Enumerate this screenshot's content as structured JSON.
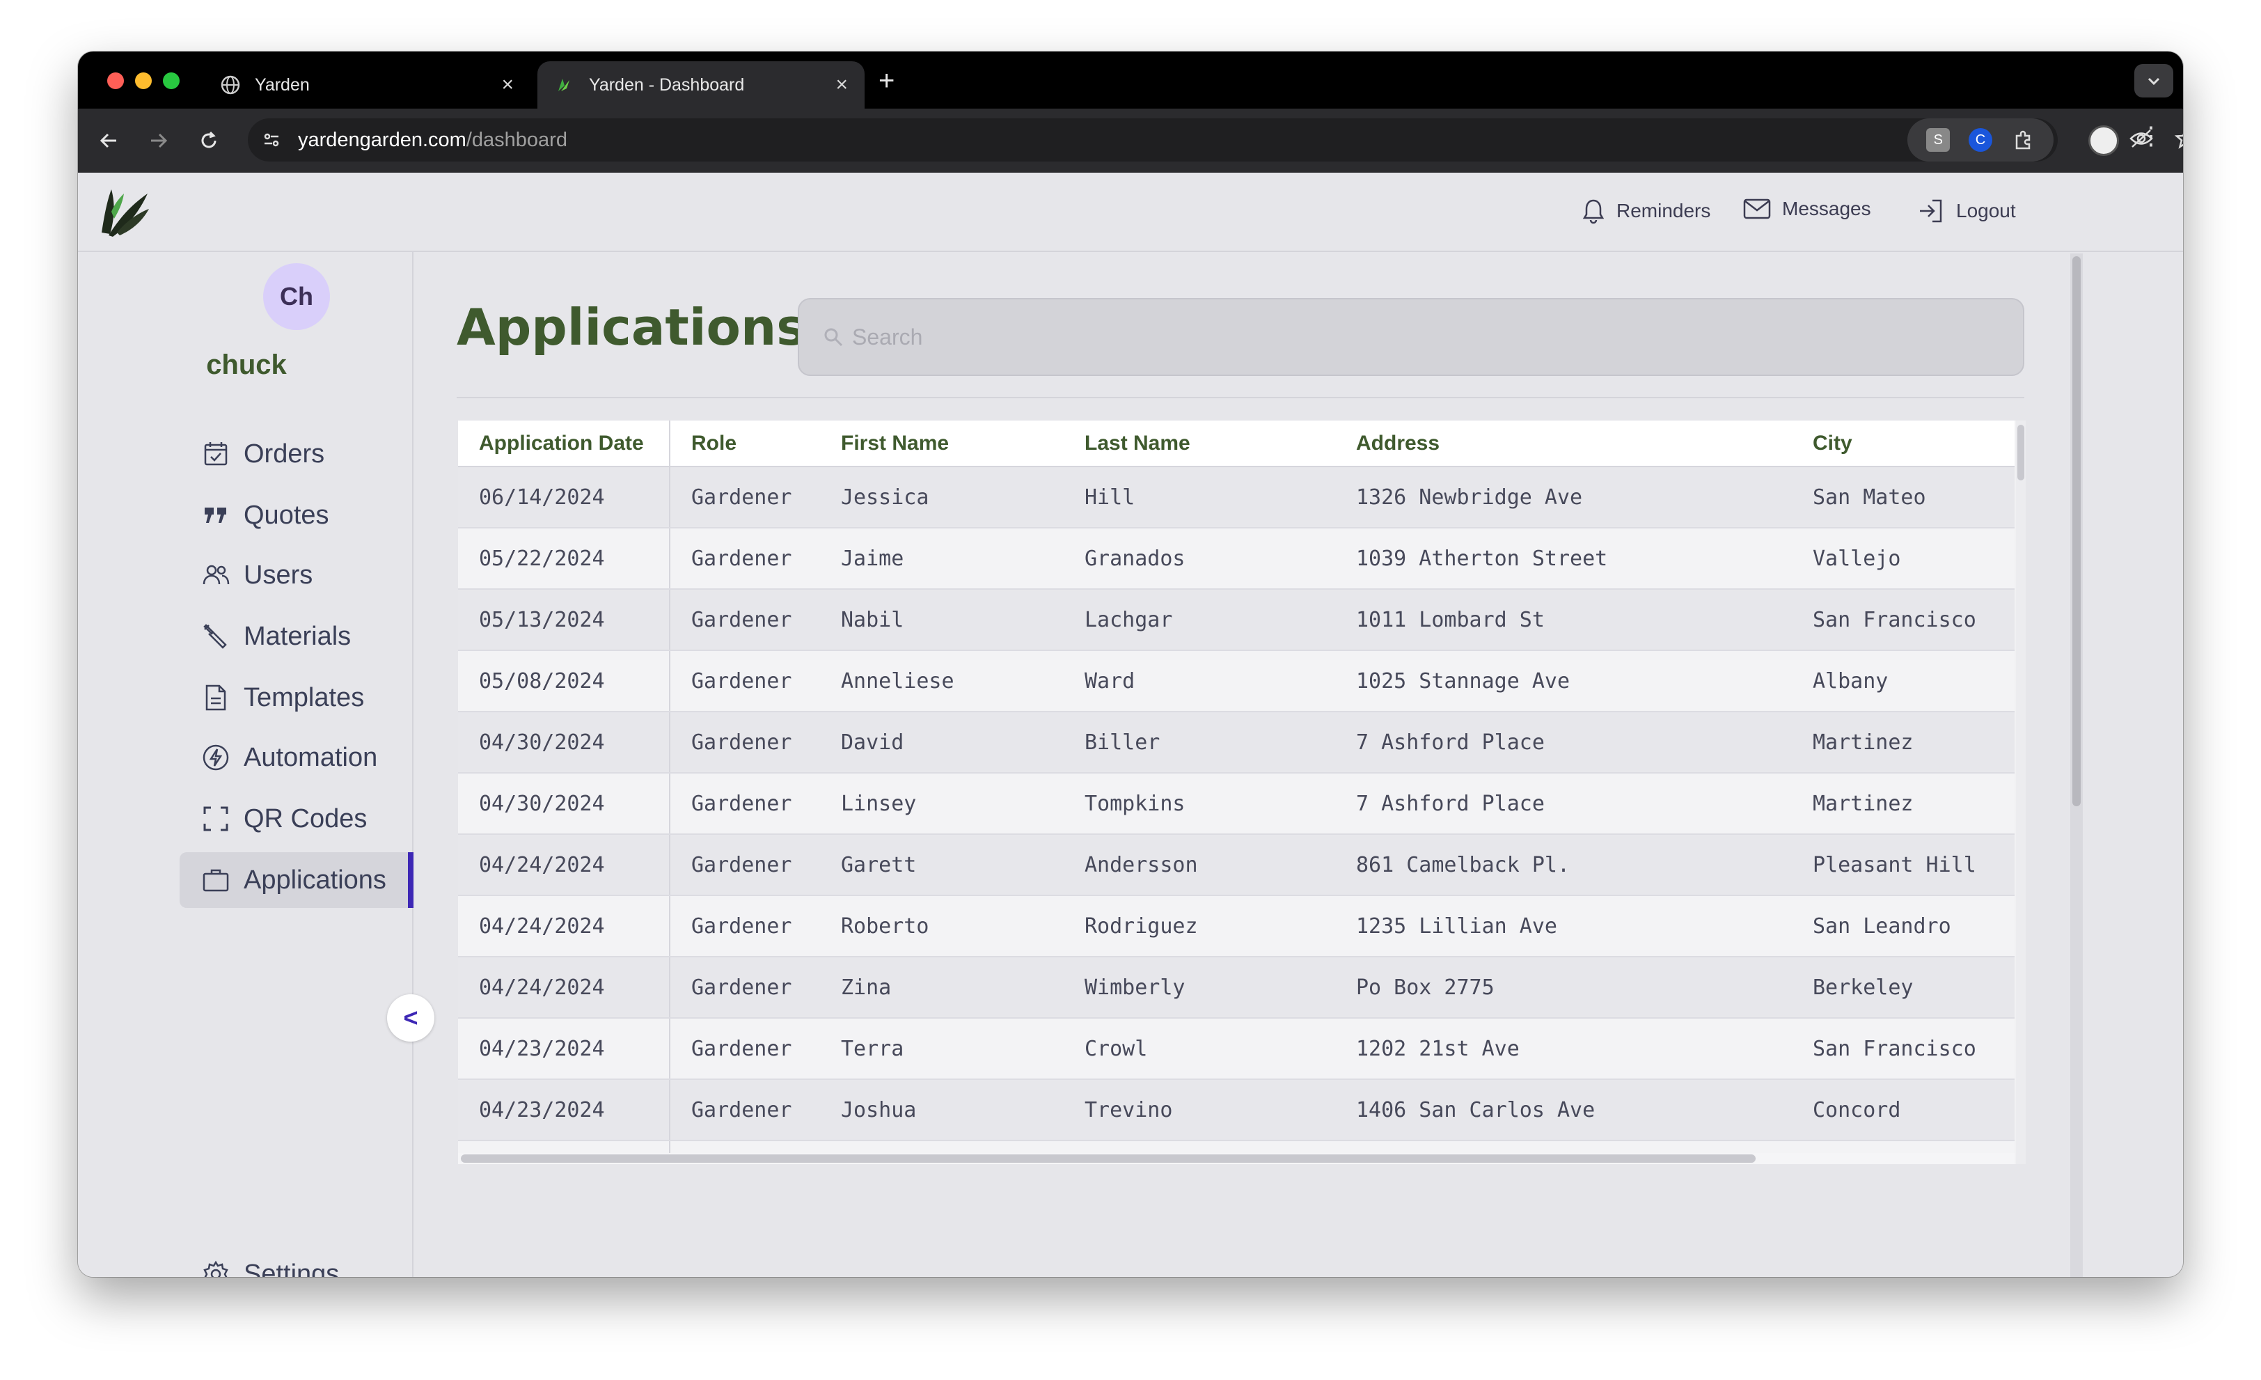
{
  "browser": {
    "tabs": [
      {
        "title": "Yarden",
        "icon": "globe-icon"
      },
      {
        "title": "Yarden - Dashboard",
        "icon": "yarden-favicon"
      }
    ],
    "new_tab_label": "+",
    "url_host": "yardengarden.com",
    "url_path": "/dashboard"
  },
  "header": {
    "reminders": "Reminders",
    "messages": "Messages",
    "logout": "Logout"
  },
  "user": {
    "initials": "Ch",
    "name": "chuck"
  },
  "sidebar": {
    "items": [
      {
        "label": "Orders",
        "icon": "calendar-check-icon"
      },
      {
        "label": "Quotes",
        "icon": "quote-icon"
      },
      {
        "label": "Users",
        "icon": "users-icon"
      },
      {
        "label": "Materials",
        "icon": "tools-icon"
      },
      {
        "label": "Templates",
        "icon": "document-icon"
      },
      {
        "label": "Automation",
        "icon": "lightning-icon"
      },
      {
        "label": "QR Codes",
        "icon": "scan-icon"
      },
      {
        "label": "Applications",
        "icon": "briefcase-icon",
        "active": true
      }
    ],
    "settings": "Settings",
    "collapse": "<"
  },
  "main": {
    "title": "Applications",
    "search_placeholder": "Search"
  },
  "table": {
    "columns": [
      "Application Date",
      "Role",
      "First Name",
      "Last Name",
      "Address",
      "City"
    ],
    "rows": [
      [
        "06/14/2024",
        "Gardener",
        "Jessica",
        "Hill",
        "1326 Newbridge Ave",
        "San Mateo"
      ],
      [
        "05/22/2024",
        "Gardener",
        "Jaime",
        "Granados",
        "1039 Atherton Street",
        "Vallejo"
      ],
      [
        "05/13/2024",
        "Gardener",
        "Nabil",
        "Lachgar",
        "1011 Lombard St",
        "San Francisco"
      ],
      [
        "05/08/2024",
        "Gardener",
        "Anneliese",
        "Ward",
        "1025 Stannage Ave",
        "Albany"
      ],
      [
        "04/30/2024",
        "Gardener",
        "David",
        "Biller",
        "7 Ashford Place",
        "Martinez"
      ],
      [
        "04/30/2024",
        "Gardener",
        "Linsey",
        "Tompkins",
        "7 Ashford Place",
        "Martinez"
      ],
      [
        "04/24/2024",
        "Gardener",
        "Garett",
        "Andersson",
        "861 Camelback Pl.",
        "Pleasant Hill"
      ],
      [
        "04/24/2024",
        "Gardener",
        "Roberto",
        "Rodriguez",
        "1235 Lillian Ave",
        "San Leandro"
      ],
      [
        "04/24/2024",
        "Gardener",
        "Zina",
        "Wimberly",
        "Po Box 2775",
        "Berkeley"
      ],
      [
        "04/23/2024",
        "Gardener",
        "Terra",
        "Crowl",
        "1202 21st Ave",
        "San Francisco"
      ],
      [
        "04/23/2024",
        "Gardener",
        "Joshua",
        "Trevino",
        "1406 San Carlos Ave",
        "Concord"
      ]
    ]
  },
  "colors": {
    "brand_green": "#3f5a2e",
    "accent_purple": "#3d27b5",
    "avatar_bg": "#d9cffa"
  }
}
